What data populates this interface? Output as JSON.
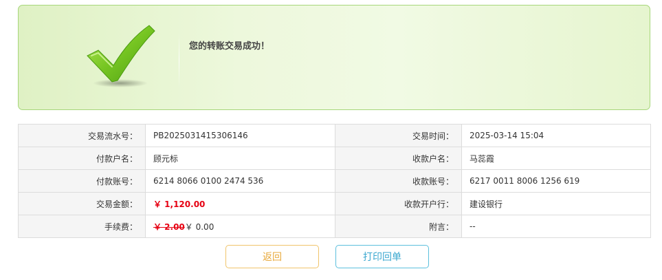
{
  "banner": {
    "icon": "checkmark-icon",
    "message": "您的转账交易成功！",
    "colors": {
      "border": "#a6d67a",
      "background": "#e8f6d2",
      "check": "#6cc11f"
    }
  },
  "details": {
    "rows": [
      {
        "left_label": "交易流水号：",
        "left_value": "PB2025031415306146",
        "right_label": "交易时间：",
        "right_value": "2025-03-14 15:04"
      },
      {
        "left_label": "付款户名：",
        "left_value": "顾元标",
        "right_label": "收款户名：",
        "right_value": "马蕊霞"
      },
      {
        "left_label": "付款账号：",
        "left_value": "6214 8066 0100 2474 536",
        "right_label": "收款账号：",
        "right_value": "6217 0011 8006 1256 619"
      },
      {
        "left_label": "交易金额：",
        "left_value": "￥ 1,120.00",
        "right_label": "收款开户行：",
        "right_value": "建设银行"
      },
      {
        "left_label": "手续费：",
        "fee_original": "￥ 2.00",
        "fee_actual": "￥ 0.00",
        "right_label": "附言：",
        "right_value": "--"
      }
    ],
    "colors": {
      "amount": "#e60012",
      "label_bg": "#f5f5f5",
      "border": "#dcdcdc"
    }
  },
  "actions": {
    "back_label": "返回",
    "print_label": "打印回单",
    "colors": {
      "back": "#e8a93c",
      "print": "#3aa7cf"
    }
  }
}
